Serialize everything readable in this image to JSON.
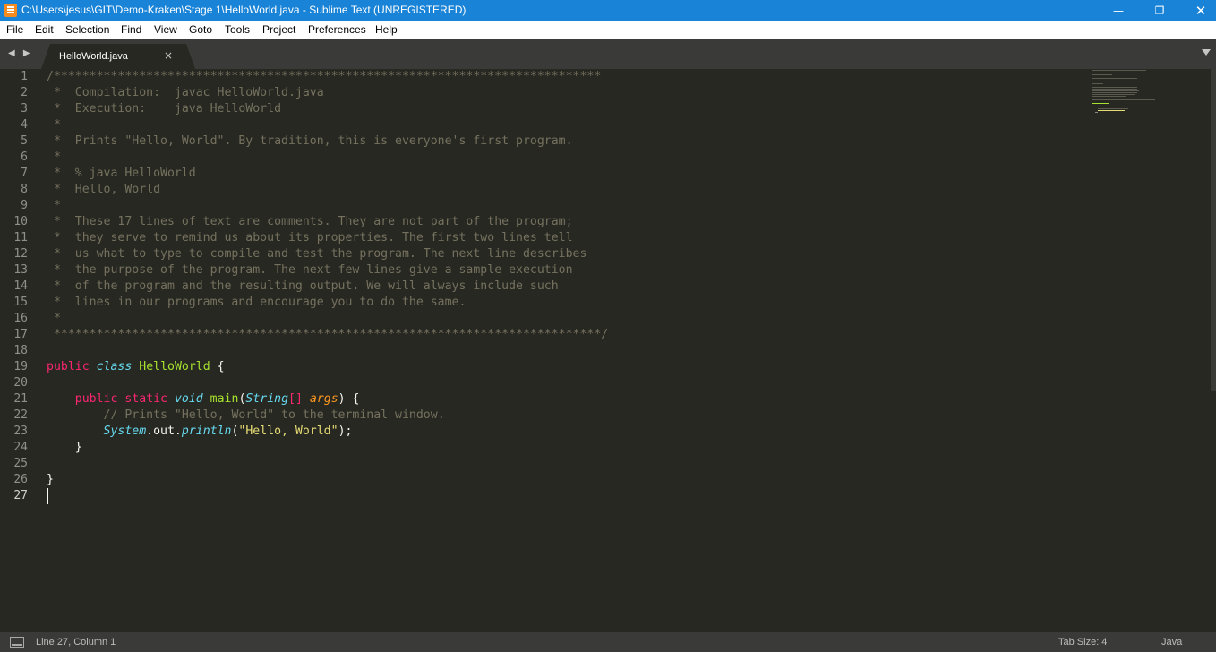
{
  "window": {
    "title": "C:\\Users\\jesus\\GIT\\Demo-Kraken\\Stage 1\\HelloWorld.java - Sublime Text (UNREGISTERED)",
    "minimize": "—",
    "maximize": "❐",
    "close": "✕"
  },
  "menu": [
    "File",
    "Edit",
    "Selection",
    "Find",
    "View",
    "Goto",
    "Tools",
    "Project",
    "Preferences",
    "Help"
  ],
  "tabs": {
    "nav": "◀ ▶",
    "active_tab": "HelloWorld.java",
    "close": "×"
  },
  "editor": {
    "line_numbers": [
      "1",
      "2",
      "3",
      "4",
      "5",
      "6",
      "7",
      "8",
      "9",
      "10",
      "11",
      "12",
      "13",
      "14",
      "15",
      "16",
      "17",
      "18",
      "19",
      "20",
      "21",
      "22",
      "23",
      "24",
      "25",
      "26",
      "27"
    ],
    "active_line": 27,
    "lines": [
      [
        {
          "t": "/*****************************************************************************",
          "c": "cm"
        }
      ],
      [
        {
          "t": " *  Compilation:  javac HelloWorld.java",
          "c": "cm"
        }
      ],
      [
        {
          "t": " *  Execution:    java HelloWorld",
          "c": "cm"
        }
      ],
      [
        {
          "t": " *",
          "c": "cm"
        }
      ],
      [
        {
          "t": " *  Prints \"Hello, World\". By tradition, this is everyone's first program.",
          "c": "cm"
        }
      ],
      [
        {
          "t": " *",
          "c": "cm"
        }
      ],
      [
        {
          "t": " *  % java HelloWorld",
          "c": "cm"
        }
      ],
      [
        {
          "t": " *  Hello, World",
          "c": "cm"
        }
      ],
      [
        {
          "t": " *",
          "c": "cm"
        }
      ],
      [
        {
          "t": " *  These 17 lines of text are comments. They are not part of the program;",
          "c": "cm"
        }
      ],
      [
        {
          "t": " *  they serve to remind us about its properties. The first two lines tell",
          "c": "cm"
        }
      ],
      [
        {
          "t": " *  us what to type to compile and test the program. The next line describes",
          "c": "cm"
        }
      ],
      [
        {
          "t": " *  the purpose of the program. The next few lines give a sample execution",
          "c": "cm"
        }
      ],
      [
        {
          "t": " *  of the program and the resulting output. We will always include such",
          "c": "cm"
        }
      ],
      [
        {
          "t": " *  lines in our programs and encourage you to do the same.",
          "c": "cm"
        }
      ],
      [
        {
          "t": " *",
          "c": "cm"
        }
      ],
      [
        {
          "t": " *****************************************************************************/",
          "c": "cm"
        }
      ],
      [],
      [
        {
          "t": "public",
          "c": "kw"
        },
        {
          "t": " ",
          "c": "pl"
        },
        {
          "t": "class",
          "c": "st"
        },
        {
          "t": " ",
          "c": "pl"
        },
        {
          "t": "HelloWorld",
          "c": "cn"
        },
        {
          "t": " {",
          "c": "pl"
        }
      ],
      [],
      [
        {
          "t": "    ",
          "c": "pl"
        },
        {
          "t": "public",
          "c": "kw"
        },
        {
          "t": " ",
          "c": "pl"
        },
        {
          "t": "static",
          "c": "kw"
        },
        {
          "t": " ",
          "c": "pl"
        },
        {
          "t": "void",
          "c": "st"
        },
        {
          "t": " ",
          "c": "pl"
        },
        {
          "t": "main",
          "c": "fn"
        },
        {
          "t": "(",
          "c": "pl"
        },
        {
          "t": "String",
          "c": "ty"
        },
        {
          "t": "[]",
          "c": "kw"
        },
        {
          "t": " ",
          "c": "pl"
        },
        {
          "t": "args",
          "c": "pr"
        },
        {
          "t": ") {",
          "c": "pl"
        }
      ],
      [
        {
          "t": "        ",
          "c": "pl"
        },
        {
          "t": "// Prints \"Hello, World\" to the terminal window.",
          "c": "cm"
        }
      ],
      [
        {
          "t": "        ",
          "c": "pl"
        },
        {
          "t": "System",
          "c": "ty"
        },
        {
          "t": ".out.",
          "c": "pl"
        },
        {
          "t": "println",
          "c": "ty"
        },
        {
          "t": "(",
          "c": "pl"
        },
        {
          "t": "\"Hello, World\"",
          "c": "str"
        },
        {
          "t": ");",
          "c": "pl"
        }
      ],
      [
        {
          "t": "    }",
          "c": "pl"
        }
      ],
      [],
      [
        {
          "t": "}",
          "c": "pl"
        }
      ],
      []
    ]
  },
  "colors": {
    "background": "#272822",
    "comment": "#75715e",
    "keyword": "#f92672",
    "storage": "#66d9ef",
    "class_name": "#a6e22e",
    "parameter": "#fd971f",
    "string": "#e6db74",
    "titlebar": "#1883d7"
  },
  "status": {
    "position": "Line 27, Column 1",
    "tab_size": "Tab Size: 4",
    "syntax": "Java"
  }
}
